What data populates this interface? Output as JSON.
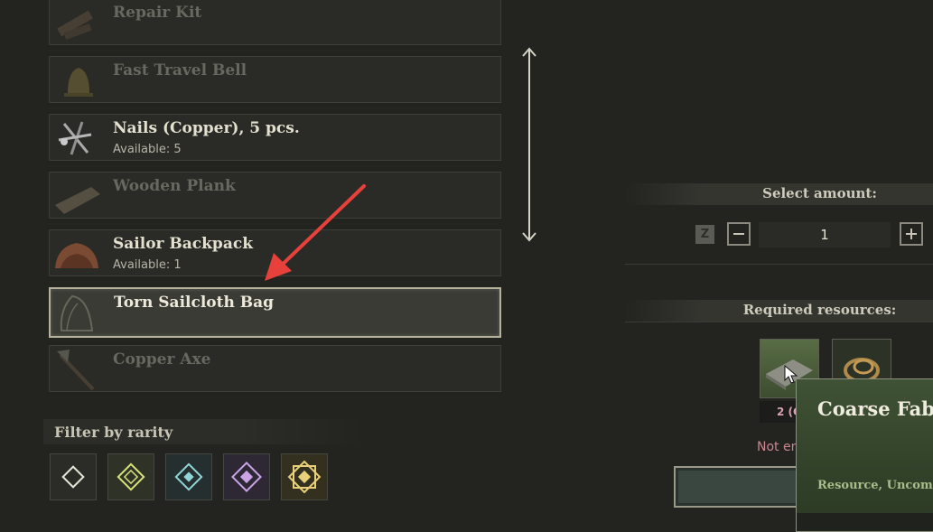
{
  "recipes": [
    {
      "name": "Repair Kit",
      "available": null,
      "state": "unavailable"
    },
    {
      "name": "Fast Travel Bell",
      "available": null,
      "state": "unavailable"
    },
    {
      "name": "Nails (Copper), 5 pcs.",
      "available": "Available: 5",
      "state": "available"
    },
    {
      "name": "Wooden Plank",
      "available": null,
      "state": "unavailable"
    },
    {
      "name": "Sailor Backpack",
      "available": "Available: 1",
      "state": "available"
    },
    {
      "name": "Torn Sailcloth Bag",
      "available": null,
      "state": "selected"
    },
    {
      "name": "Copper Axe",
      "available": null,
      "state": "unavailable"
    }
  ],
  "filter": {
    "title": "Filter by rarity",
    "rarities": [
      {
        "name": "common",
        "color": "#e8e6da"
      },
      {
        "name": "uncommon",
        "color": "#d9e27a"
      },
      {
        "name": "rare",
        "color": "#8fd6d9"
      },
      {
        "name": "epic",
        "color": "#c9a3e6"
      },
      {
        "name": "legendary",
        "color": "#e8d07a"
      }
    ]
  },
  "amount": {
    "title": "Select amount:",
    "hotkey": "Z",
    "value": "1"
  },
  "resources": {
    "title": "Required resources:",
    "count_label": "2 (C",
    "not_enough": "Not en"
  },
  "tooltip": {
    "title": "Coarse Fabr",
    "subtitle": "Resource, Uncom"
  },
  "annotation": {
    "arrow_color": "#e8403a"
  }
}
